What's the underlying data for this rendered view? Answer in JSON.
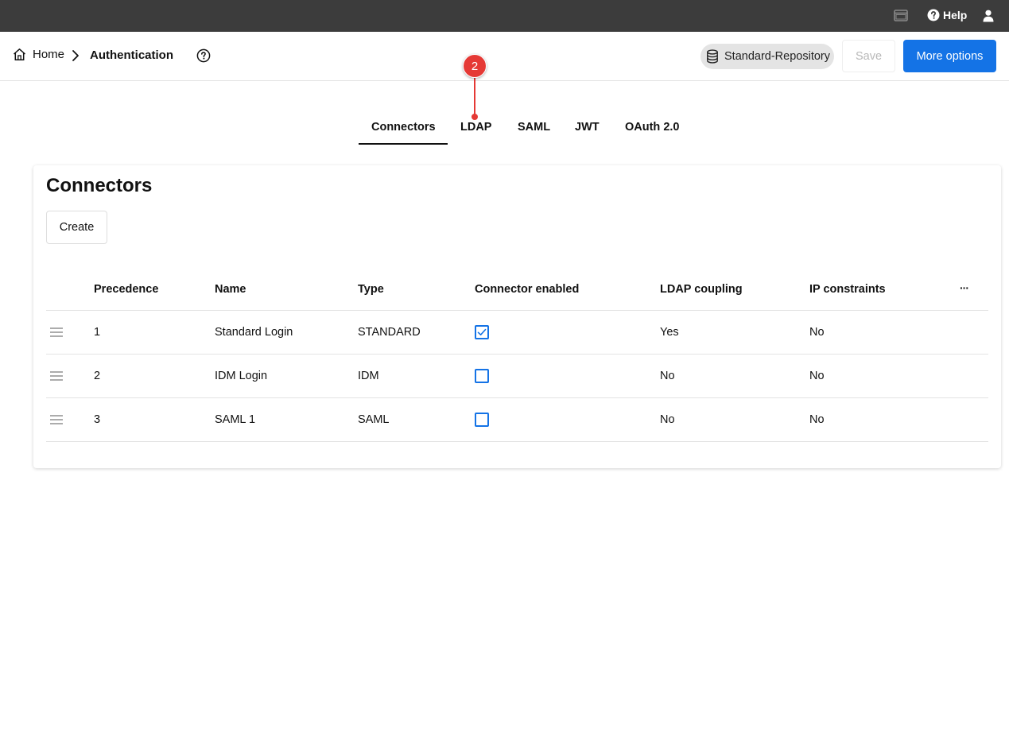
{
  "topbar": {
    "window_icon": "window-icon",
    "help_label": "Help",
    "help_icon": "question-circle-icon",
    "user_icon": "user-icon"
  },
  "header": {
    "breadcrumb": {
      "home_label": "Home",
      "current_label": "Authentication"
    },
    "repository_label": "Standard-Repository",
    "save_label": "Save",
    "more_options_label": "More options"
  },
  "tabs": [
    {
      "label": "Connectors",
      "active": true
    },
    {
      "label": "LDAP",
      "active": false
    },
    {
      "label": "SAML",
      "active": false
    },
    {
      "label": "JWT",
      "active": false
    },
    {
      "label": "OAuth 2.0",
      "active": false
    }
  ],
  "annotation_marker": {
    "label": "2"
  },
  "card": {
    "title": "Connectors",
    "create_label": "Create",
    "columns": [
      "Precedence",
      "Name",
      "Type",
      "Connector enabled",
      "LDAP coupling",
      "IP constraints"
    ],
    "more_columns_label": "···",
    "rows": [
      {
        "precedence": "1",
        "name": "Standard Login",
        "type": "STANDARD",
        "enabled": true,
        "ldap": "Yes",
        "ip": "No"
      },
      {
        "precedence": "2",
        "name": "IDM Login",
        "type": "IDM",
        "enabled": false,
        "ldap": "No",
        "ip": "No"
      },
      {
        "precedence": "3",
        "name": "SAML 1",
        "type": "SAML",
        "enabled": false,
        "ldap": "No",
        "ip": "No"
      }
    ]
  },
  "colors": {
    "topbar": "#3c3c3c",
    "primary": "#1473e6",
    "marker": "#e53935"
  }
}
